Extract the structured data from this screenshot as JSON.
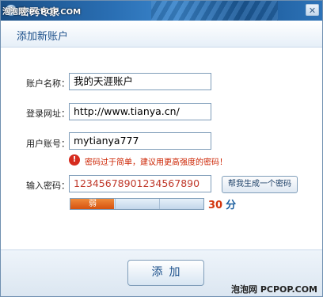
{
  "window": {
    "title": "密码专家",
    "close_glyph": "✕"
  },
  "watermark": {
    "top": "泡泡网 PCPOP.COM",
    "bottom": "泡泡网 PCPOP.COM"
  },
  "header": {
    "title": "添加新账户"
  },
  "form": {
    "account_name": {
      "label": "账户名称：",
      "value": "我的天涯账户"
    },
    "login_url": {
      "label": "登录网址：",
      "value": "http://www.tianya.cn/"
    },
    "username": {
      "label": "用户账号：",
      "value": "mytianya777"
    },
    "warning": {
      "icon": "!",
      "text": "密码过于简单，建议用更高强度的密码！"
    },
    "password": {
      "label": "输入密码：",
      "value": "12345678901234567890"
    },
    "generate_button": "帮我生成一个密码",
    "strength": {
      "label": "弱",
      "score": "30",
      "unit": "分",
      "fill_fraction": 0.33
    }
  },
  "footer": {
    "add_button": "添加"
  },
  "colors": {
    "accent": "#1b4f8a",
    "warning": "#cc2200",
    "strength_fill": "#d4520f"
  }
}
